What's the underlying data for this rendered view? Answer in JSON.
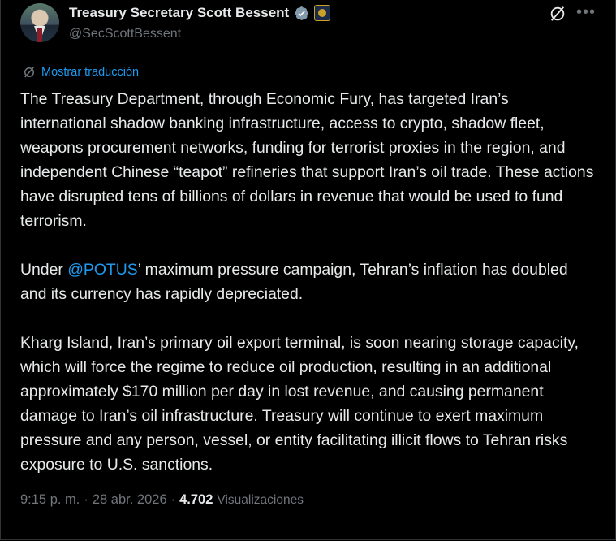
{
  "author": {
    "name": "Treasury Secretary Scott Bessent",
    "handle": "@SecScottBessent",
    "verified_color": "#829aab"
  },
  "translate_label": "Mostrar traducción",
  "post": {
    "p1": "The Treasury Department, through Economic Fury, has targeted Iran’s international shadow banking infrastructure, access to crypto, shadow fleet, weapons procurement networks, funding for terrorist proxies in the region, and independent Chinese “teapot” refineries that support Iran’s oil trade. These actions have disrupted tens of billions of dollars in revenue that would be used to fund terrorism.",
    "p2_prefix": "Under ",
    "p2_mention": "@POTUS",
    "p2_suffix": "’ maximum pressure campaign, Tehran’s inflation has doubled and its currency has rapidly depreciated.",
    "p3": "Kharg Island, Iran’s primary oil export terminal, is soon nearing storage capacity, which will force the regime to reduce oil production, resulting in an additional approximately $170 million per day in lost revenue, and causing permanent damage to Iran’s oil infrastructure. Treasury will continue to exert maximum pressure and any person, vessel, or entity facilitating illicit flows to Tehran risks exposure to U.S. sanctions."
  },
  "meta": {
    "time": "9:15 p. m.",
    "sep1": "·",
    "date": "28 abr. 2026",
    "sep2": "·",
    "views_count": "4.702",
    "views_label": "Visualizaciones"
  },
  "icons": {
    "grok": "grok-icon",
    "more": "more-icon",
    "translate": "translate-icon",
    "verified": "verified-badge-icon",
    "gov": "government-badge-icon"
  },
  "colors": {
    "accent": "#1d9bf0",
    "muted": "#71767b",
    "text": "#e7e9ea",
    "background": "#000000"
  }
}
